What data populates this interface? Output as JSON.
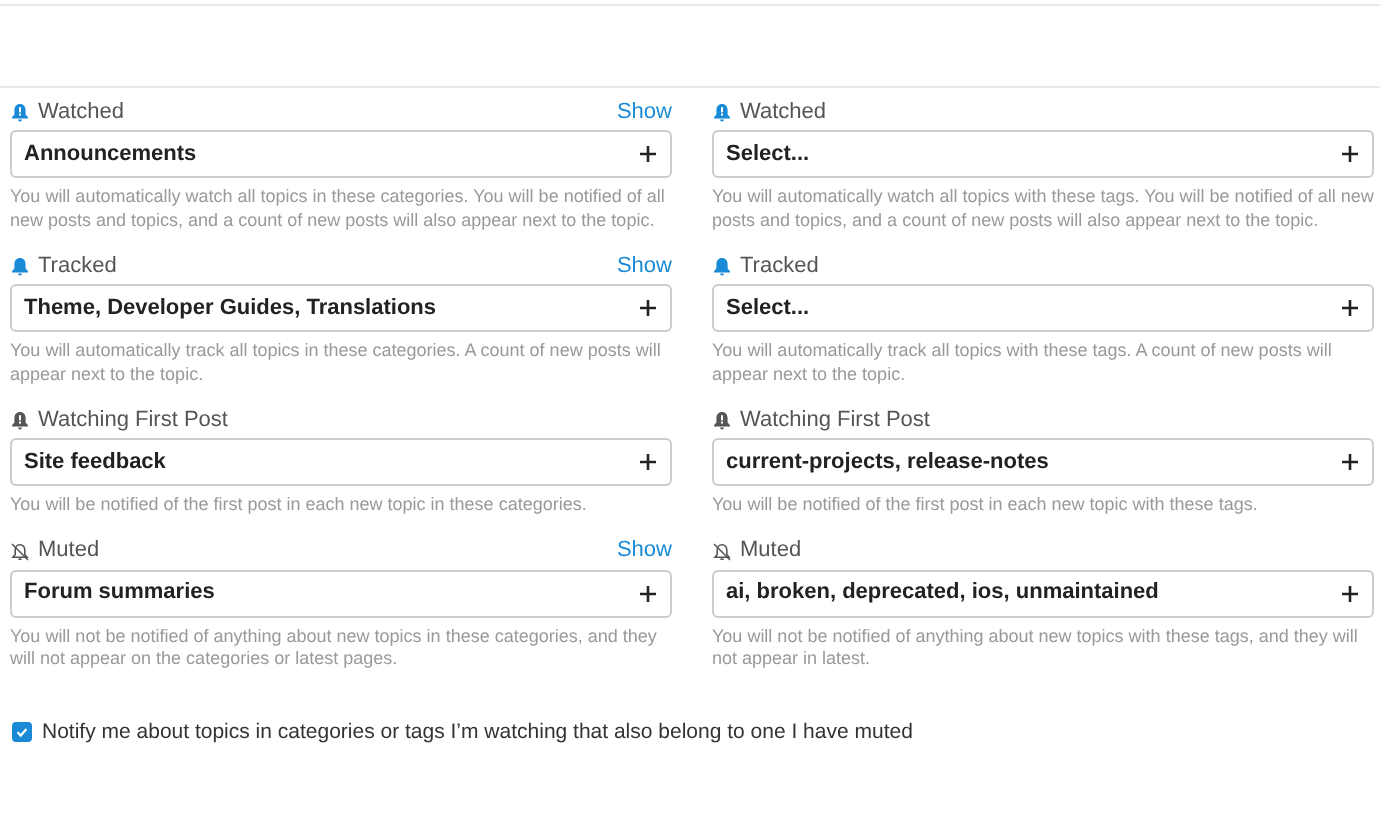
{
  "categories": [
    {
      "kind": "watched",
      "label": "Watched",
      "show_link": "Show",
      "value": "Announcements",
      "description": "You will automatically watch all topics in these categories. You will be notified of all new posts and topics, and a count of new posts will also appear next to the topic."
    },
    {
      "kind": "tracked",
      "label": "Tracked",
      "show_link": "Show",
      "value": "Theme, Developer Guides, Translations",
      "description": "You will automatically track all topics in these categories. A count of new posts will appear next to the topic."
    },
    {
      "kind": "first",
      "label": "Watching First Post",
      "value": "Site feedback",
      "description": "You will be notified of the first post in each new topic in these categories."
    },
    {
      "kind": "muted",
      "label": "Muted",
      "show_link": "Show",
      "value": "Forum summaries",
      "description": "You will not be notified of anything about new topics in these categories, and they will not appear on the categories or latest pages."
    }
  ],
  "tags": [
    {
      "kind": "watched",
      "label": "Watched",
      "value": "Select...",
      "description": "You will automatically watch all topics with these tags. You will be notified of all new posts and topics, and a count of new posts will also appear next to the topic."
    },
    {
      "kind": "tracked",
      "label": "Tracked",
      "value": "Select...",
      "description": "You will automatically track all topics with these tags. A count of new posts will appear next to the topic."
    },
    {
      "kind": "first",
      "label": "Watching First Post",
      "value": "current-projects, release-notes",
      "description": "You will be notified of the first post in each new topic with these tags."
    },
    {
      "kind": "muted",
      "label": "Muted",
      "value": "ai, broken, deprecated, ios, unmaintained",
      "description": "You will not be notified of anything about new topics with these tags, and they will not appear in latest."
    }
  ],
  "notify_muted": {
    "label": "Notify me about topics in categories or tags I’m watching that also belong to one I have muted",
    "checked": true
  }
}
